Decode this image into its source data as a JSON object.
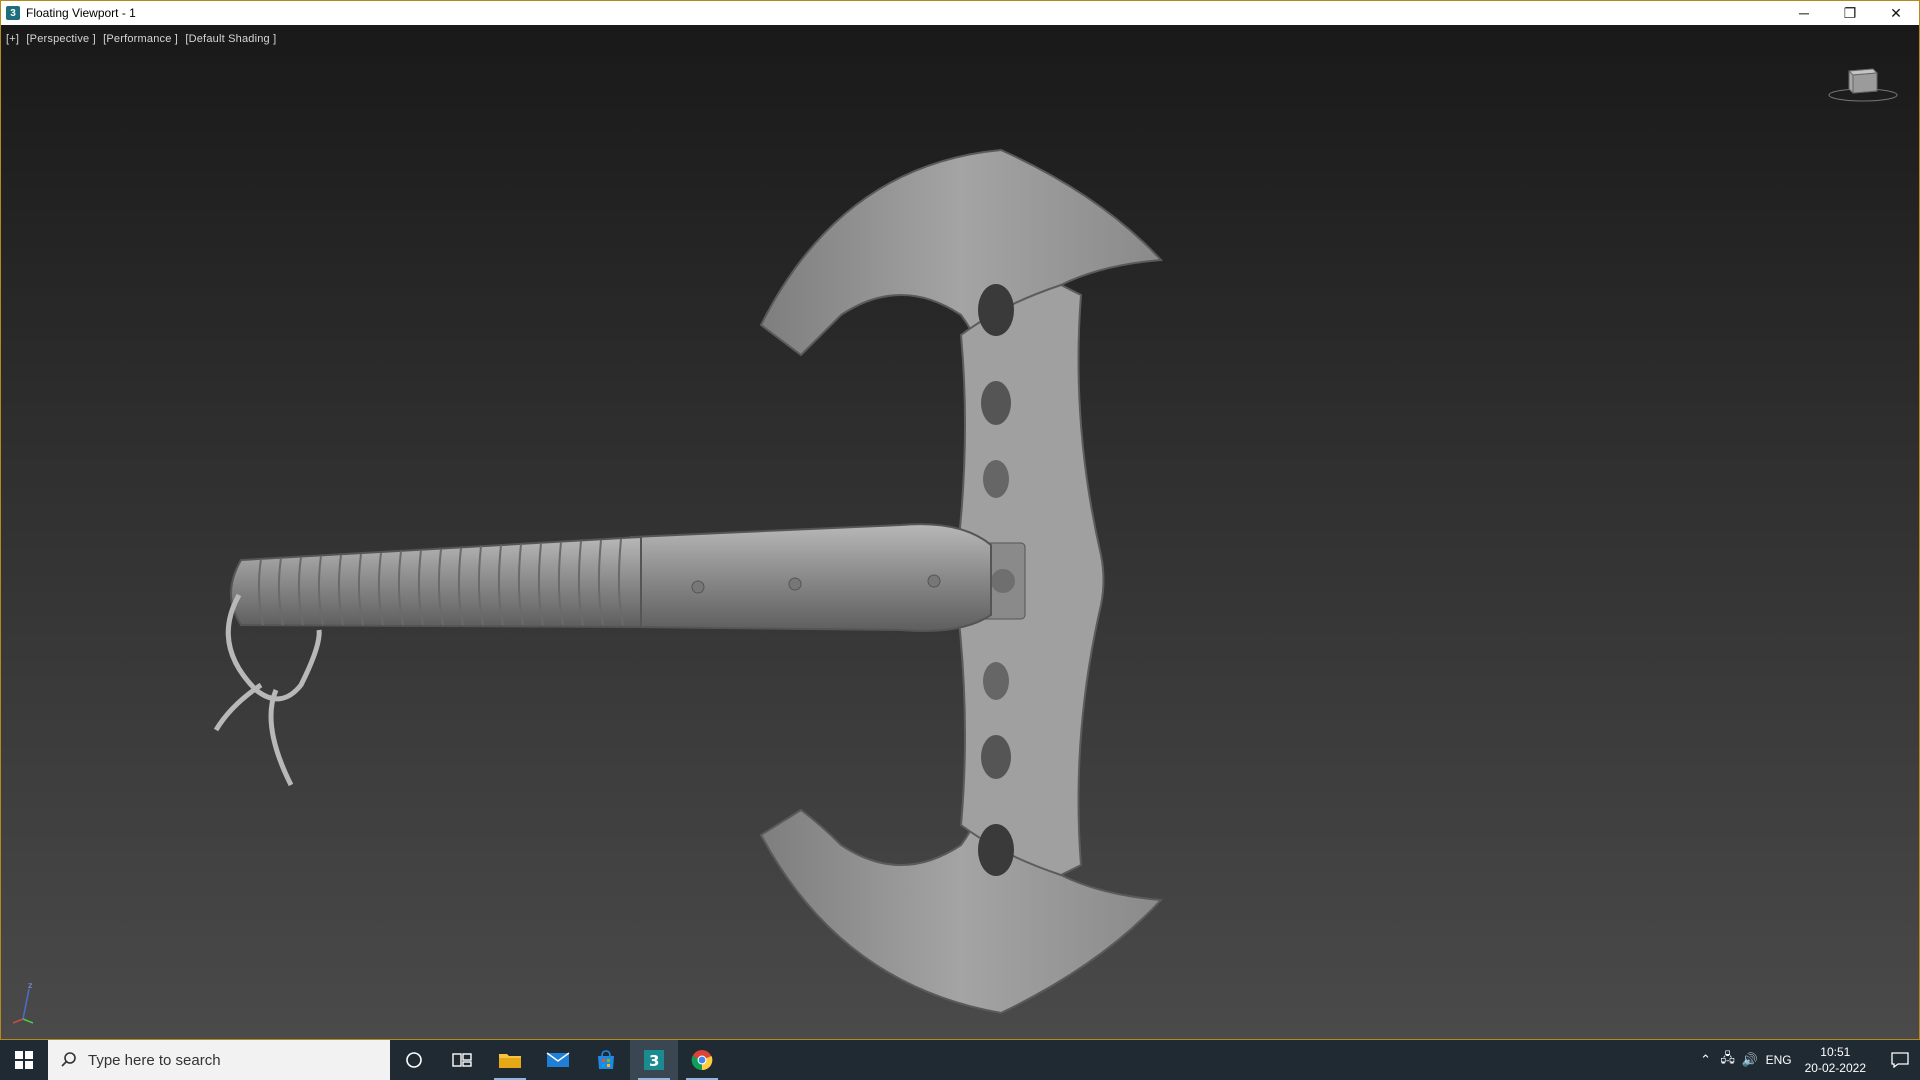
{
  "window": {
    "title": "Floating Viewport - 1",
    "app_icon_letter": "3",
    "minimize_glyph": "─",
    "restore_glyph": "❐",
    "close_glyph": "✕"
  },
  "viewport": {
    "labels": [
      "[+]",
      "[Perspective ]",
      "[Performance ]",
      "[Default Shading ]"
    ],
    "gizmo_axis": "z",
    "background_top": "#191919",
    "background_bottom": "#4a4a4a",
    "model_color": "#9a9a9a"
  },
  "taskbar": {
    "search_placeholder": "Type here to search",
    "pinned": [
      {
        "name": "cortana-icon"
      },
      {
        "name": "task-view-icon"
      },
      {
        "name": "file-explorer-icon"
      },
      {
        "name": "mail-icon"
      },
      {
        "name": "store-icon"
      },
      {
        "name": "3ds-max-icon",
        "active": true
      },
      {
        "name": "chrome-icon"
      }
    ],
    "language": "ENG",
    "time": "10:51",
    "date": "20-02-2022",
    "accent": "#8fb8de"
  }
}
